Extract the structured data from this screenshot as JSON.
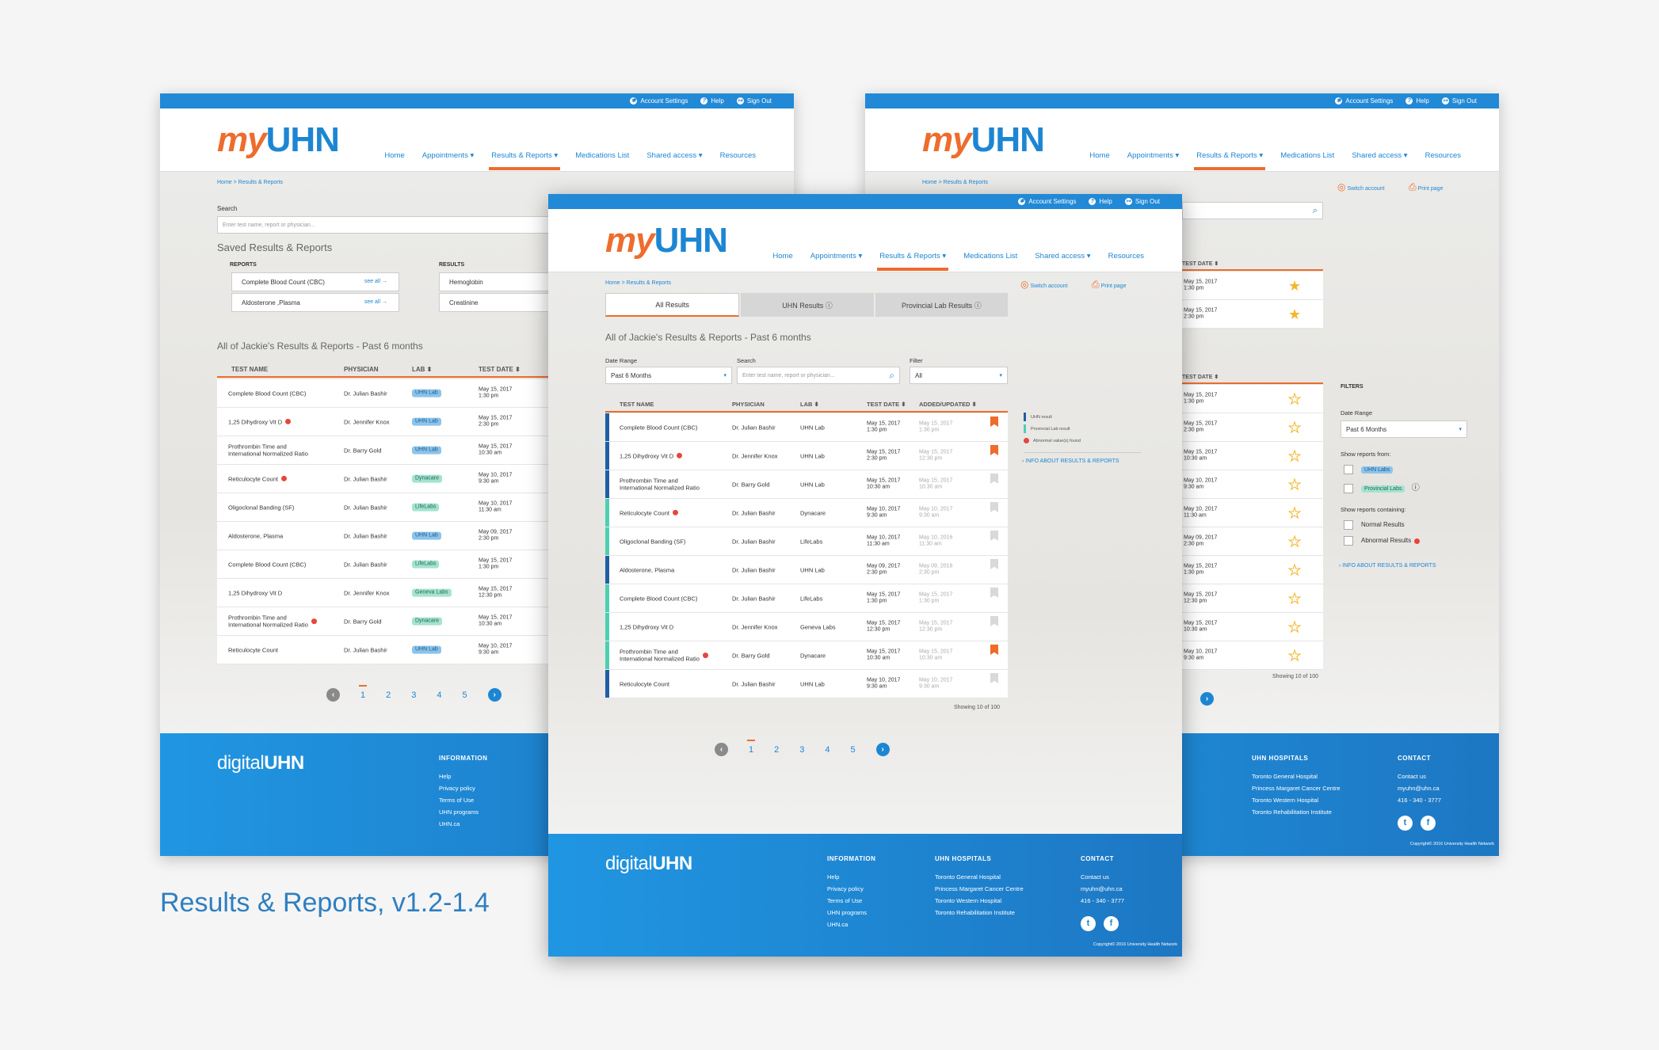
{
  "caption": "Results & Reports, v1.2-1.4",
  "topbar": {
    "account_settings": "Account Settings",
    "help": "Help",
    "sign_out": "Sign Out"
  },
  "logo": {
    "my": "my",
    "uhn": "UHN"
  },
  "nav": [
    {
      "label": "Home"
    },
    {
      "label": "Appointments ▾"
    },
    {
      "label": "Results & Reports ▾"
    },
    {
      "label": "Medications List"
    },
    {
      "label": "Shared access ▾"
    },
    {
      "label": "Resources"
    }
  ],
  "breadcrumb": "Home  >  Results & Reports",
  "actions": {
    "switch_account": "Switch account",
    "print_page": "Print page"
  },
  "left": {
    "search_label": "Search",
    "search_placeholder": "Enter test name, report or physician...",
    "saved_title": "Saved Results & Reports",
    "reports_label": "REPORTS",
    "results_label": "RESULTS",
    "reports": [
      {
        "name": "Complete Blood Count (CBC)",
        "link": "see all →"
      },
      {
        "name": "Aldosterone ,Plasma",
        "link": "see all →"
      }
    ],
    "results": [
      "Hemoglobin",
      "Creatinine"
    ],
    "section_title": "All of Jackie's Results & Reports - Past 6 months",
    "headers": [
      "TEST NAME",
      "PHYSICIAN",
      "LAB ⬍",
      "TEST DATE ⬍"
    ],
    "rows": [
      {
        "test": "Complete Blood Count (CBC)",
        "physician": "Dr. Julian Bashir",
        "lab": "UHN Lab",
        "date": "May 15, 2017\n1:30 pm"
      },
      {
        "test": "1,25 Dihydroxy Vit D",
        "physician": "Dr. Jennifer Knox",
        "lab": "UHN Lab",
        "date": "May 15, 2017\n2:30 pm"
      },
      {
        "test": "Prothrombin Time and\nInternational Normalized Ratio",
        "physician": "Dr. Barry Gold",
        "lab": "UHN Lab",
        "date": "May 15, 2017\n10:30 am"
      },
      {
        "test": "Reticulocyte Count",
        "physician": "Dr. Julian Bashir",
        "lab": "Dynacare",
        "date": "May 10, 2017\n9:30 am"
      },
      {
        "test": "Oligoclonal Banding (SF)",
        "physician": "Dr. Julian Bashir",
        "lab": "LifeLabs",
        "date": "May 10, 2017\n11:30 am"
      },
      {
        "test": "Aldosterone, Plasma",
        "physician": "Dr. Julian Bashir",
        "lab": "UHN Lab",
        "date": "May 09, 2017\n2:30 pm"
      },
      {
        "test": "Complete Blood Count (CBC)",
        "physician": "Dr. Julian Bashir",
        "lab": "LifeLabs",
        "date": "May 15, 2017\n1:30 pm"
      },
      {
        "test": "1,25 Dihydroxy Vit D",
        "physician": "Dr. Jennifer Knox",
        "lab": "Geneva Labs",
        "date": "May 15, 2017\n12:30 pm"
      },
      {
        "test": "Prothrombin Time and\nInternational Normalized Ratio",
        "physician": "Dr. Barry Gold",
        "lab": "Dynacare",
        "date": "May 15, 2017\n10:30 am"
      },
      {
        "test": "Reticulocyte Count",
        "physician": "Dr. Julian Bashir",
        "lab": "UHN Lab",
        "date": "May 10, 2017\n9:30 am"
      }
    ]
  },
  "center": {
    "tabs": [
      "All Results",
      "UHN Results ⓘ",
      "Provincial Lab Results ⓘ"
    ],
    "section_title": "All of Jackie's Results & Reports - Past 6 months",
    "date_range_label": "Date Range",
    "date_range_value": "Past 6 Months",
    "search_label": "Search",
    "search_placeholder": "Enter test name, report or physician...",
    "filter_label": "Filter",
    "filter_value": "All",
    "headers": [
      "TEST NAME",
      "PHYSICIAN",
      "LAB ⬍",
      "TEST DATE ⬍",
      "ADDED/UPDATED ⬍"
    ],
    "rows": [
      {
        "test": "Complete Blood Count (CBC)",
        "physician": "Dr. Julian Bashir",
        "lab": "UHN Lab",
        "date": "May 15, 2017\n1:30 pm",
        "added": "May 15, 2017\n1:30 pm"
      },
      {
        "test": "1,25 Dihydroxy Vit D",
        "physician": "Dr. Jennifer Knox",
        "lab": "UHN Lab",
        "date": "May 15, 2017\n2:30 pm",
        "added": "May 15, 2017\n12:30 pm"
      },
      {
        "test": "Prothrombin Time and\nInternational Normalized Ratio",
        "physician": "Dr. Barry Gold",
        "lab": "UHN Lab",
        "date": "May 15, 2017\n10:30 am",
        "added": "May 15, 2017\n10:30 am"
      },
      {
        "test": "Reticulocyte Count",
        "physician": "Dr. Julian Bashir",
        "lab": "Dynacare",
        "date": "May 10, 2017\n9:30 am",
        "added": "May 10, 2017\n9:30 am"
      },
      {
        "test": "Oligoclonal Banding (SF)",
        "physician": "Dr. Julian Bashir",
        "lab": "LifeLabs",
        "date": "May 10, 2017\n11:30 am",
        "added": "May 10, 2016\n11:30 am"
      },
      {
        "test": "Aldosterone, Plasma",
        "physician": "Dr. Julian Bashir",
        "lab": "UHN Lab",
        "date": "May 09, 2017\n2:30 pm",
        "added": "May 09, 2016\n2:30 pm"
      },
      {
        "test": "Complete Blood Count (CBC)",
        "physician": "Dr. Julian Bashir",
        "lab": "LifeLabs",
        "date": "May 15, 2017\n1:30 pm",
        "added": "May 15, 2017\n1:30 pm"
      },
      {
        "test": "1,25 Dihydroxy Vit D",
        "physician": "Dr. Jennifer Knox",
        "lab": "Geneva Labs",
        "date": "May 15, 2017\n12:30 pm",
        "added": "May 15, 2017\n12:30 pm"
      },
      {
        "test": "Prothrombin Time and\nInternational Normalized Ratio",
        "physician": "Dr. Barry Gold",
        "lab": "Dynacare",
        "date": "May 15, 2017\n10:30 am",
        "added": "May 15, 2017\n10:30 am"
      },
      {
        "test": "Reticulocyte Count",
        "physician": "Dr. Julian Bashir",
        "lab": "UHN Lab",
        "date": "May 10, 2017\n9:30 am",
        "added": "May 10, 2017\n9:30 am"
      }
    ],
    "showing": "Showing 10 of 100",
    "legend": [
      "UHN result",
      "Provincial Lab result",
      "Abnormal value(s) found"
    ],
    "info_link": "INFO ABOUT RESULTS & REPORTS"
  },
  "right": {
    "test_date_header": "TEST DATE ⬍",
    "top_rows": [
      {
        "date": "May 15, 2017\n1:30 pm"
      },
      {
        "date": "May 15, 2017\n2:30 pm"
      }
    ],
    "rows": [
      {
        "date": "May 15, 2017\n1:30 pm"
      },
      {
        "date": "May 15, 2017\n2:30 pm"
      },
      {
        "date": "May 15, 2017\n10:30 am"
      },
      {
        "date": "May 10, 2017\n9:30 am"
      },
      {
        "date": "May 10, 2017\n11:30 am"
      },
      {
        "date": "May 09, 2017\n2:30 pm"
      },
      {
        "date": "May 15, 2017\n1:30 pm"
      },
      {
        "date": "May 15, 2017\n12:30 pm"
      },
      {
        "date": "May 15, 2017\n10:30 am"
      },
      {
        "date": "May 10, 2017\n9:30 am"
      }
    ],
    "showing": "Showing 10 of 100",
    "filters_label": "FILTERS",
    "date_range_label": "Date Range",
    "date_range_value": "Past 6 Months",
    "show_from_label": "Show reports from:",
    "uhn_labs": "UHN Labs",
    "provincial_labs": "Provincial Labs",
    "show_containing_label": "Show reports containing:",
    "normal_results": "Normal Results",
    "abnormal_results": "Abnormal Results",
    "info_link": "INFO ABOUT RESULTS & REPORTS"
  },
  "pager": {
    "pages": [
      "1",
      "2",
      "3",
      "4",
      "5"
    ]
  },
  "footer": {
    "logo_digital": "digital",
    "logo_uhn": "UHN",
    "info_title": "INFORMATION",
    "info_links": [
      "Help",
      "Privacy policy",
      "Terms of Use",
      "UHN programs",
      "UHN.ca"
    ],
    "hosp_title": "UHN HOSPITALS",
    "hospitals": [
      "Toronto General Hospital",
      "Princess Margaret Cancer Centre",
      "Toronto Western Hospital",
      "Toronto Rehabilitation Institute"
    ],
    "contact_title": "CONTACT",
    "contact": [
      "Contact us",
      "myuhn@uhn.ca",
      "416 - 340 - 3777"
    ],
    "copyright": "Copyright© 2016 University Health Network"
  },
  "colors": {
    "brand_blue": "#1d86d3",
    "brand_orange": "#ee6c2c",
    "uhn_bar": "#1e5fa6",
    "prov_bar": "#4cd0b1",
    "abnormal": "#e8453c",
    "star": "#f3b72a"
  }
}
